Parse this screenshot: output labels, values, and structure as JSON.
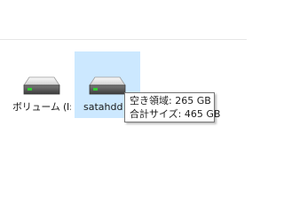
{
  "drives": [
    {
      "label": "ボリューム (I:)",
      "selected": false,
      "icon": "hard-drive-icon"
    },
    {
      "label": "satahdd (",
      "selected": true,
      "icon": "hard-drive-icon"
    }
  ],
  "tooltip": {
    "free_space": "空き領域: 265 GB",
    "total_size": "合計サイズ: 465 GB"
  },
  "colors": {
    "selection": "#cce8ff",
    "drive_indicator": "#32cd32"
  }
}
